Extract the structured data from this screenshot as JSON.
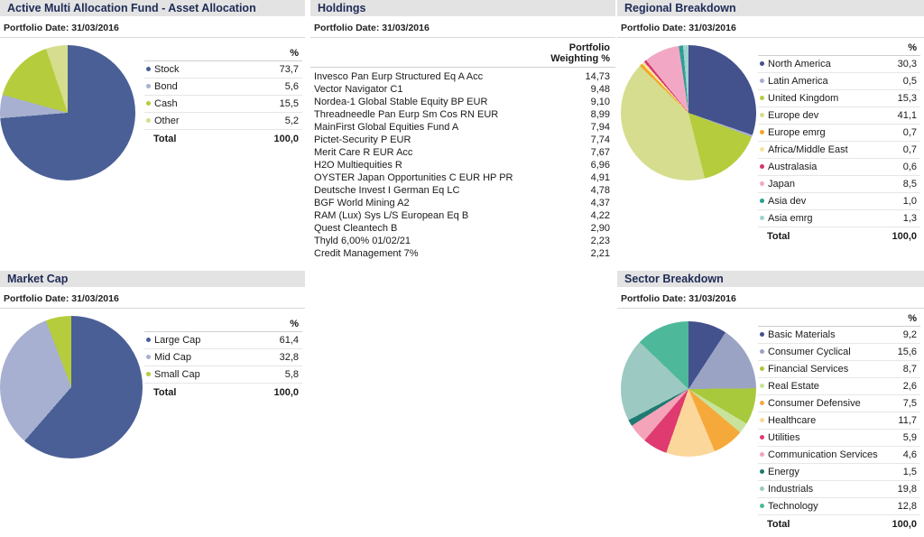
{
  "panels": {
    "asset_allocation": {
      "title": "Active Multi Allocation Fund - Asset Allocation",
      "portfolio_date": "Portfolio Date: 31/03/2016",
      "pct_header": "%",
      "total_label": "Total",
      "total_value": "100,0"
    },
    "holdings": {
      "title": "Holdings",
      "portfolio_date": "Portfolio Date: 31/03/2016",
      "col_header_line1": "Portfolio",
      "col_header_line2": "Weighting %"
    },
    "regional": {
      "title": "Regional Breakdown",
      "portfolio_date": "Portfolio Date: 31/03/2016",
      "pct_header": "%",
      "total_label": "Total",
      "total_value": "100,0"
    },
    "market_cap": {
      "title": "Market Cap",
      "portfolio_date": "Portfolio Date: 31/03/2016",
      "pct_header": "%",
      "total_label": "Total",
      "total_value": "100,0"
    },
    "sector": {
      "title": "Sector Breakdown",
      "portfolio_date": "Portfolio Date: 31/03/2016",
      "pct_header": "%",
      "total_label": "Total",
      "total_value": "100,0"
    }
  },
  "holdings_rows": [
    {
      "name": "Invesco Pan Eurp Structured Eq A Acc",
      "weight": "14,73"
    },
    {
      "name": "Vector Navigator C1",
      "weight": "9,48"
    },
    {
      "name": "Nordea-1 Global Stable Equity BP EUR",
      "weight": "9,10"
    },
    {
      "name": "Threadneedle Pan Eurp Sm Cos RN EUR",
      "weight": "8,99"
    },
    {
      "name": "MainFirst Global Equities Fund A",
      "weight": "7,94"
    },
    {
      "name": "Pictet-Security P EUR",
      "weight": "7,74"
    },
    {
      "name": "Merit Care R EUR Acc",
      "weight": "7,67"
    },
    {
      "name": "H2O Multiequities R",
      "weight": "6,96"
    },
    {
      "name": "OYSTER Japan Opportunities C EUR HP PR",
      "weight": "4,91"
    },
    {
      "name": "Deutsche Invest I German Eq LC",
      "weight": "4,78"
    },
    {
      "name": "BGF World Mining A2",
      "weight": "4,37"
    },
    {
      "name": "RAM (Lux) Sys L/S European Eq B",
      "weight": "4,22"
    },
    {
      "name": "Quest Cleantech B",
      "weight": "2,90"
    },
    {
      "name": "Thyld 6,00% 01/02/21",
      "weight": "2,23"
    },
    {
      "name": "Credit Management 7%",
      "weight": "2,21"
    }
  ],
  "chart_data": [
    {
      "id": "asset_allocation",
      "type": "pie",
      "title": "Active Multi Allocation Fund - Asset Allocation",
      "unit": "%",
      "categories": [
        "Stock",
        "Bond",
        "Cash",
        "Other"
      ],
      "values": [
        73.7,
        5.6,
        15.5,
        5.2
      ],
      "display_values": [
        "73,7",
        "5,6",
        "15,5",
        "5,2"
      ],
      "colors": [
        "#4a5f96",
        "#a7b0d0",
        "#b5cd3c",
        "#d6dd8e"
      ],
      "total": 100.0
    },
    {
      "id": "regional",
      "type": "pie",
      "title": "Regional Breakdown",
      "unit": "%",
      "categories": [
        "North America",
        "Latin America",
        "United Kingdom",
        "Europe dev",
        "Europe emrg",
        "Africa/Middle East",
        "Australasia",
        "Japan",
        "Asia dev",
        "Asia emrg"
      ],
      "values": [
        30.3,
        0.5,
        15.3,
        41.1,
        0.7,
        0.7,
        0.6,
        8.5,
        1.0,
        1.3
      ],
      "display_values": [
        "30,3",
        "0,5",
        "15,3",
        "41,1",
        "0,7",
        "0,7",
        "0,6",
        "8,5",
        "1,0",
        "1,3"
      ],
      "colors": [
        "#43518c",
        "#a7b0d0",
        "#b5cd3c",
        "#d6dd8e",
        "#f5a623",
        "#f7e3a1",
        "#d6356f",
        "#f2a8c4",
        "#2e9e94",
        "#9fd2ce"
      ],
      "total": 100.0
    },
    {
      "id": "market_cap",
      "type": "pie",
      "title": "Market Cap",
      "unit": "%",
      "categories": [
        "Large Cap",
        "Mid Cap",
        "Small Cap"
      ],
      "values": [
        61.4,
        32.8,
        5.8
      ],
      "display_values": [
        "61,4",
        "32,8",
        "5,8"
      ],
      "colors": [
        "#4a5f96",
        "#a7b0d0",
        "#b5cd3c"
      ],
      "total": 100.0
    },
    {
      "id": "sector",
      "type": "pie",
      "title": "Sector Breakdown",
      "unit": "%",
      "categories": [
        "Basic Materials",
        "Consumer Cyclical",
        "Financial Services",
        "Real Estate",
        "Consumer Defensive",
        "Healthcare",
        "Utilities",
        "Communication Services",
        "Energy",
        "Industrials",
        "Technology"
      ],
      "values": [
        9.2,
        15.6,
        8.7,
        2.6,
        7.5,
        11.7,
        5.9,
        4.6,
        1.5,
        19.8,
        12.8
      ],
      "display_values": [
        "9,2",
        "15,6",
        "8,7",
        "2,6",
        "7,5",
        "11,7",
        "5,9",
        "4,6",
        "1,5",
        "19,8",
        "12,8"
      ],
      "colors": [
        "#43518c",
        "#9aa3c4",
        "#a9c93c",
        "#c8e39b",
        "#f6a93b",
        "#fbd79b",
        "#df3b70",
        "#f4a3b8",
        "#1f7a72",
        "#9cc9c2",
        "#4db99a"
      ],
      "total": 100.0
    }
  ]
}
